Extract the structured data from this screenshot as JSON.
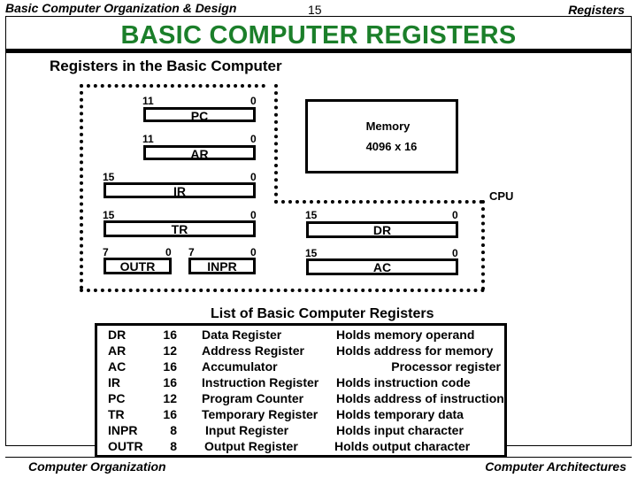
{
  "header": {
    "left": "Basic Computer Organization & Design",
    "page_number": "15",
    "right": "Registers"
  },
  "title": "BASIC COMPUTER  REGISTERS",
  "title_color": "#1b7f2a",
  "subtitle": "Registers in the Basic Computer",
  "diagram": {
    "cpu_label": "CPU",
    "memory": {
      "label": "Memory",
      "size": "4096 x 16"
    },
    "registers": {
      "PC": {
        "name": "PC",
        "msb": "11",
        "lsb": "0"
      },
      "AR": {
        "name": "AR",
        "msb": "11",
        "lsb": "0"
      },
      "IR": {
        "name": "IR",
        "msb": "15",
        "lsb": "0"
      },
      "TR": {
        "name": "TR",
        "msb": "15",
        "lsb": "0"
      },
      "OUTR": {
        "name": "OUTR",
        "msb": "7",
        "lsb": "0"
      },
      "INPR": {
        "name": "INPR",
        "msb": "7",
        "lsb": "0"
      },
      "DR": {
        "name": "DR",
        "msb": "15",
        "lsb": "0"
      },
      "AC": {
        "name": "AC",
        "msb": "15",
        "lsb": "0"
      }
    }
  },
  "list": {
    "title": "List of Basic Computer Registers",
    "rows": [
      {
        "symbol": "DR",
        "bits": "16",
        "name": "Data Register",
        "function": "Holds memory operand"
      },
      {
        "symbol": "AR",
        "bits": "12",
        "name": "Address Register",
        "function": "Holds address for memory"
      },
      {
        "symbol": "AC",
        "bits": "16",
        "name": "Accumulator",
        "function": "Processor register"
      },
      {
        "symbol": "IR",
        "bits": "16",
        "name": "Instruction Register",
        "function": "Holds instruction code"
      },
      {
        "symbol": "PC",
        "bits": "12",
        "name": "Program Counter",
        "function": "Holds address of instruction"
      },
      {
        "symbol": "TR",
        "bits": "16",
        "name": "Temporary Register",
        "function": "Holds temporary data"
      },
      {
        "symbol": "INPR",
        "bits": "8",
        "name": "Input Register",
        "function": "Holds input character"
      },
      {
        "symbol": "OUTR",
        "bits": "8",
        "name": "Output Register",
        "function": "Holds output character"
      }
    ]
  },
  "footer": {
    "left": "Computer Organization",
    "right": "Computer Architectures"
  }
}
